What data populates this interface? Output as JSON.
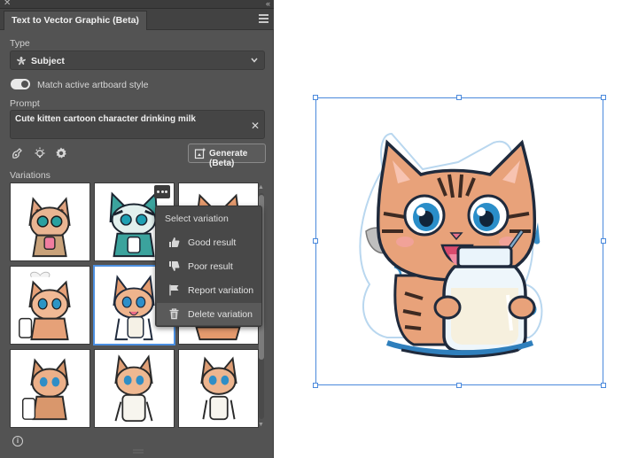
{
  "panel": {
    "title": "Text to Vector Graphic (Beta)",
    "close_glyph": "✕",
    "collapse_glyph": "«",
    "type_label": "Type",
    "type_value": "Subject",
    "match_style_label": "Match active artboard style",
    "match_style_on": true,
    "prompt_label": "Prompt",
    "prompt_value": "Cute kitten cartoon character drinking milk",
    "clear_glyph": "✕",
    "generate_label": "Generate (Beta)",
    "variations_label": "Variations",
    "info_glyph": "i"
  },
  "context_menu": {
    "title": "Select variation",
    "items": [
      {
        "label": "Good result",
        "icon": "thumbs-up-icon"
      },
      {
        "label": "Poor result",
        "icon": "thumbs-down-icon"
      },
      {
        "label": "Report variation",
        "icon": "flag-icon"
      },
      {
        "label": "Delete variation",
        "icon": "trash-icon"
      }
    ]
  },
  "colors": {
    "panel_bg": "#535353",
    "selection_blue": "#4a89dc",
    "cat_orange": "#e8a27a",
    "cat_dark": "#1f2a3c",
    "milk_blue": "#3a8fc8"
  }
}
